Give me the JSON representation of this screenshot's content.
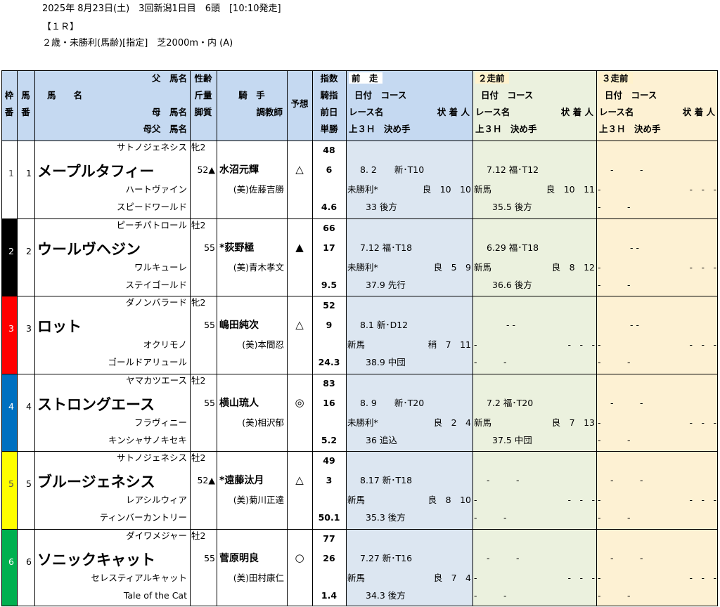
{
  "header": {
    "line1": "2025年 8月23日(土)　3回新潟1日目　6頭　[10:10発走]",
    "line2": "【１Ｒ】",
    "line3": "２歳・未勝利(馬齢)[指定]　芝2000m・内 (A)"
  },
  "columns": {
    "waku": [
      "枠",
      "番"
    ],
    "uma": [
      "馬",
      "番"
    ],
    "name": [
      "父　馬名",
      "馬　　名",
      "母　馬名",
      "母父　馬名"
    ],
    "sex": [
      "性齢",
      "斤量",
      "脚質"
    ],
    "jockey": [
      "騎　手",
      "調教師"
    ],
    "yoso": "予想",
    "index": [
      "指数",
      "騎指",
      "前日",
      "単勝"
    ],
    "race_headers": [
      {
        "title": "前　走",
        "l2": "日付　コース",
        "l3": "レース名",
        "l3r": "状 着 人",
        "l4": "上３Ｈ　決め手"
      },
      {
        "title": "２走前",
        "l2": "日付　コース",
        "l3": "レース名",
        "l3r": "状 着 人",
        "l4": "上３Ｈ　決め手"
      },
      {
        "title": "３走前",
        "l2": "日付　コース",
        "l3": "レース名",
        "l3r": "状 着 人",
        "l4": "上３Ｈ　決め手"
      }
    ]
  },
  "colors": {
    "header_bg": "#c5d9f1",
    "race1_bg": "#dce6f1",
    "race2_bg": "#ebf1de",
    "race3_bg": "#fdf1d3",
    "waku": [
      "#ffffff",
      "#000000",
      "#ff0000",
      "#0070c0",
      "#ffff00",
      "#00b050"
    ]
  },
  "horses": [
    {
      "waku": "1",
      "uma": "1",
      "sire": "サトノジェネシス",
      "name": "メープルタフィー",
      "dam": "ハートヴァイン",
      "damsire": "スピードワールド",
      "sex": "牝2",
      "weight": "52▲",
      "jockey": "水沼元輝",
      "trainer": "(美)佐藤吉勝",
      "yoso": "△",
      "index": "48",
      "kishi": "6",
      "odds": "4.6",
      "r1": {
        "l1": "8. 2　　新･T10",
        "race": "未勝利*",
        "res": "良　10　10",
        "l3": "33 後方"
      },
      "r2": {
        "l1": "7.12 福･T12",
        "race": "新馬",
        "res": "良　10　11",
        "l3": "35.5 後方"
      },
      "r3": {
        "l1": "-　　　-",
        "race": "-",
        "res": "-　-　-",
        "l3": "-　　　-"
      }
    },
    {
      "waku": "2",
      "uma": "2",
      "sire": "ピーチパトロール",
      "name": "ウールヴヘジン",
      "dam": "ワルキューレ",
      "damsire": "ステイゴールド",
      "sex": "牡2",
      "weight": "55",
      "jockey": "*荻野極",
      "trainer": "(美)青木孝文",
      "yoso": "▲",
      "index": "66",
      "kishi": "17",
      "odds": "9.5",
      "r1": {
        "l1": "7.12 福･T18",
        "race": "未勝利*",
        "res": "良　5　9",
        "l3": "37.9 先行"
      },
      "r2": {
        "l1": "6.29 福･T18",
        "race": "新馬",
        "res": "良　8　12",
        "l3": "36.6 後方"
      },
      "r3": {
        "l1": "- -",
        "race": "-",
        "res": "-　-　-",
        "l3": "-　　　-"
      }
    },
    {
      "waku": "3",
      "uma": "3",
      "sire": "ダノンバラード",
      "name": "ロット",
      "dam": "オクリモノ",
      "damsire": "ゴールドアリュール",
      "sex": "牝2",
      "weight": "55",
      "jockey": "嶋田純次",
      "trainer": "(美)本間忍",
      "yoso": "△",
      "index": "52",
      "kishi": "9",
      "odds": "24.3",
      "r1": {
        "l1": "8.1 新･D12",
        "race": "新馬",
        "res": "稍　7　11",
        "l3": "38.9 中団"
      },
      "r2": {
        "l1": "- -",
        "race": "-",
        "res": "-　-　-",
        "l3": "-　　　-"
      },
      "r3": {
        "l1": "- -",
        "race": "-",
        "res": "-　-　-",
        "l3": "-　　　-"
      }
    },
    {
      "waku": "4",
      "uma": "4",
      "sire": "ヤマカツエース",
      "name": "ストロングエース",
      "dam": "フラヴィニー",
      "damsire": "キンシャサノキセキ",
      "sex": "牡2",
      "weight": "55",
      "jockey": "横山琉人",
      "trainer": "(美)相沢郁",
      "yoso": "◎",
      "index": "83",
      "kishi": "16",
      "odds": "5.2",
      "r1": {
        "l1": "8. 9　　新･T20",
        "race": "未勝利*",
        "res": "良　2　4",
        "l3": "36 追込"
      },
      "r2": {
        "l1": "7.2 福･T20",
        "race": "新馬",
        "res": "良　7　13",
        "l3": "37.5 中団"
      },
      "r3": {
        "l1": "-　　　-",
        "race": "-",
        "res": "-　-　-",
        "l3": "-　　　-"
      }
    },
    {
      "waku": "5",
      "uma": "5",
      "sire": "サトノジェネシス",
      "name": "ブルージェネシス",
      "dam": "レアシルウィア",
      "damsire": "ティンバーカントリー",
      "sex": "牡2",
      "weight": "52▲",
      "jockey": "*遠藤汰月",
      "trainer": "(美)菊川正達",
      "yoso": "△",
      "index": "49",
      "kishi": "3",
      "odds": "50.1",
      "r1": {
        "l1": "8.17 新･T18",
        "race": "新馬",
        "res": "良　8　10",
        "l3": "35.3 後方"
      },
      "r2": {
        "l1": "-　　　-",
        "race": "-",
        "res": "-　-　-",
        "l3": "-　　　-"
      },
      "r3": {
        "l1": "-　　　-",
        "race": "-",
        "res": "-　-　-",
        "l3": "-　　　-"
      }
    },
    {
      "waku": "6",
      "uma": "6",
      "sire": "ダイワメジャー",
      "name": "ソニックキャット",
      "dam": "セレスティアルキャット",
      "damsire": "Tale of the Cat",
      "sex": "牡2",
      "weight": "55",
      "jockey": "菅原明良",
      "trainer": "(美)田村康仁",
      "yoso": "○",
      "index": "77",
      "kishi": "26",
      "odds": "1.4",
      "r1": {
        "l1": "7.27 新･T16",
        "race": "新馬",
        "res": "良　7　4",
        "l3": "34.3 後方"
      },
      "r2": {
        "l1": "-　　　-",
        "race": "-",
        "res": "-　-　-",
        "l3": "-　　　-"
      },
      "r3": {
        "l1": "-　　　-",
        "race": "-",
        "res": "-　-　-",
        "l3": "-　　　-"
      }
    }
  ]
}
